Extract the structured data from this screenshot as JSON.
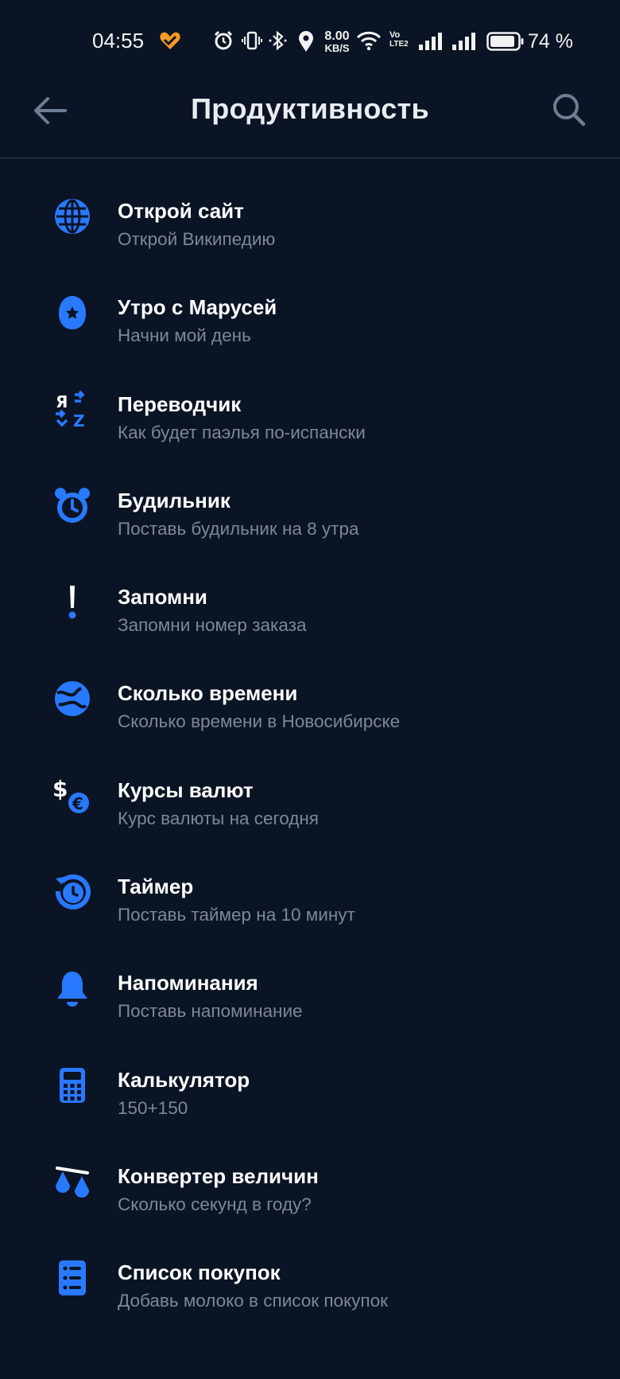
{
  "status_bar": {
    "time": "04:55",
    "speed_value": "8.00",
    "speed_unit": "KB/S",
    "volte_top": "Vo",
    "volte_bottom": "LTE2",
    "battery": "74 %"
  },
  "header": {
    "title": "Продуктивность"
  },
  "colors": {
    "background": "#0b1424",
    "accent": "#2979ff",
    "subtitle": "#7e8797"
  },
  "items": [
    {
      "icon": "globe-icon",
      "title": "Открой сайт",
      "subtitle": "Открой Википедию"
    },
    {
      "icon": "marusia-egg-icon",
      "title": "Утро с Марусей",
      "subtitle": "Начни мой день"
    },
    {
      "icon": "translate-icon",
      "title": "Переводчик",
      "subtitle": "Как будет паэлья по-испански"
    },
    {
      "icon": "alarm-clock-icon",
      "title": "Будильник",
      "subtitle": "Поставь будильник на 8 утра"
    },
    {
      "icon": "exclamation-icon",
      "title": "Запомни",
      "subtitle": "Запомни номер заказа"
    },
    {
      "icon": "earth-time-icon",
      "title": "Сколько времени",
      "subtitle": "Сколько времени в Новосибирске"
    },
    {
      "icon": "currency-icon",
      "title": "Курсы валют",
      "subtitle": "Курс валюты на сегодня"
    },
    {
      "icon": "timer-icon",
      "title": "Таймер",
      "subtitle": "Поставь таймер на 10 минут"
    },
    {
      "icon": "bell-icon",
      "title": "Напоминания",
      "subtitle": "Поставь напоминание"
    },
    {
      "icon": "calculator-icon",
      "title": "Калькулятор",
      "subtitle": "150+150"
    },
    {
      "icon": "scales-icon",
      "title": "Конвертер величин",
      "subtitle": "Сколько секунд в году?"
    },
    {
      "icon": "shopping-list-icon",
      "title": "Список покупок",
      "subtitle": "Добавь молоко в список покупок"
    }
  ]
}
